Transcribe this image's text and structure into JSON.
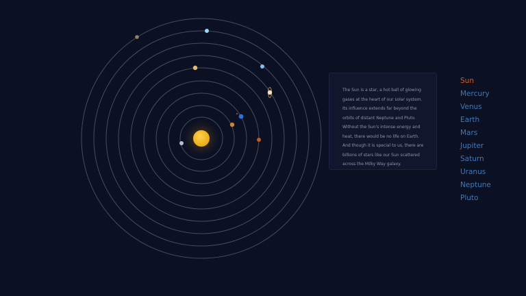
{
  "info": {
    "text": "The Sun is a star, a hot ball of glowing gases at the heart of our solar system. Its influence extends far beyond the orbits of distant Neptune and Pluto. Without the Sun's intense energy and heat, there would be no life on Earth. And though it is special to us, there are billions of stars like our Sun scattered across the Milky Way galaxy."
  },
  "nav": {
    "selected": "Sun",
    "items": [
      {
        "label": "Sun"
      },
      {
        "label": "Mercury"
      },
      {
        "label": "Venus"
      },
      {
        "label": "Earth"
      },
      {
        "label": "Mars"
      },
      {
        "label": "Jupiter"
      },
      {
        "label": "Saturn"
      },
      {
        "label": "Uranus"
      },
      {
        "label": "Neptune"
      },
      {
        "label": "Pluto"
      }
    ]
  },
  "colors": {
    "background": "#0b1023",
    "orbit": "#5b6275",
    "active_nav": "#e05a1e",
    "nav": "#3f78b7",
    "sun": "#f2b51c"
  },
  "bodies": [
    {
      "name": "sun",
      "color": "#f5bc1c"
    },
    {
      "name": "mercury",
      "color": "#b9bfc9"
    },
    {
      "name": "venus",
      "color": "#c9853a"
    },
    {
      "name": "earth",
      "color": "#2f6fe0"
    },
    {
      "name": "mars",
      "color": "#c8571c"
    },
    {
      "name": "jupiter",
      "color": "#e7b777"
    },
    {
      "name": "saturn",
      "color": "#f1e2bf"
    },
    {
      "name": "uranus",
      "color": "#82bfe8"
    },
    {
      "name": "neptune",
      "color": "#9ed4f5"
    },
    {
      "name": "pluto",
      "color": "#8f8468"
    }
  ]
}
